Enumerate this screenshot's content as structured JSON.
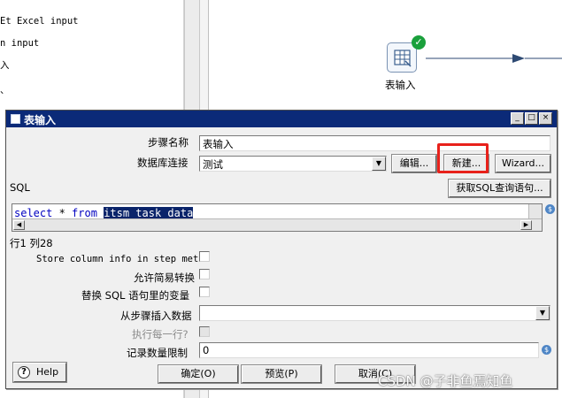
{
  "left_panel": {
    "items": [
      "Et Excel input",
      "n input",
      "入",
      "、"
    ]
  },
  "canvas": {
    "step_label": "表输入",
    "status_icon": "check-icon"
  },
  "dialog": {
    "title": "表输入",
    "window_buttons": [
      "_",
      "□",
      "×"
    ],
    "step_name_label": "步骤名称",
    "step_name_value": "表输入",
    "db_conn_label": "数据库连接",
    "db_conn_value": "测试",
    "edit_button": "编辑...",
    "new_button": "新建...",
    "wizard_button": "Wizard...",
    "sql_label": "SQL",
    "get_sql_button": "获取SQL查询语句...",
    "sql": {
      "kw_select": "select",
      "star": " * ",
      "kw_from": "from",
      "space": " ",
      "table": "itsm_task_data"
    },
    "cursor_pos": "行1 列28",
    "store_column_info_label": "Store column info in step meta",
    "lazy_conversion_label": "允许简易转换",
    "replace_variables_label": "替换 SQL 语句里的变量",
    "insert_from_step_label": "从步骤插入数据",
    "insert_from_step_value": "",
    "execute_each_row_label": "执行每一行?",
    "limit_label": "记录数量限制",
    "limit_value": "0",
    "help_button": "Help",
    "ok_button": "确定(O)",
    "preview_button": "预览(P)",
    "cancel_button": "取消(C)"
  },
  "watermark": "CSDN @子非鱼焉知鱼",
  "colors": {
    "titlebar": "#0b2a78",
    "highlight": "#e8211b",
    "selection": "#0a246a",
    "keyword": "#0000c0"
  }
}
